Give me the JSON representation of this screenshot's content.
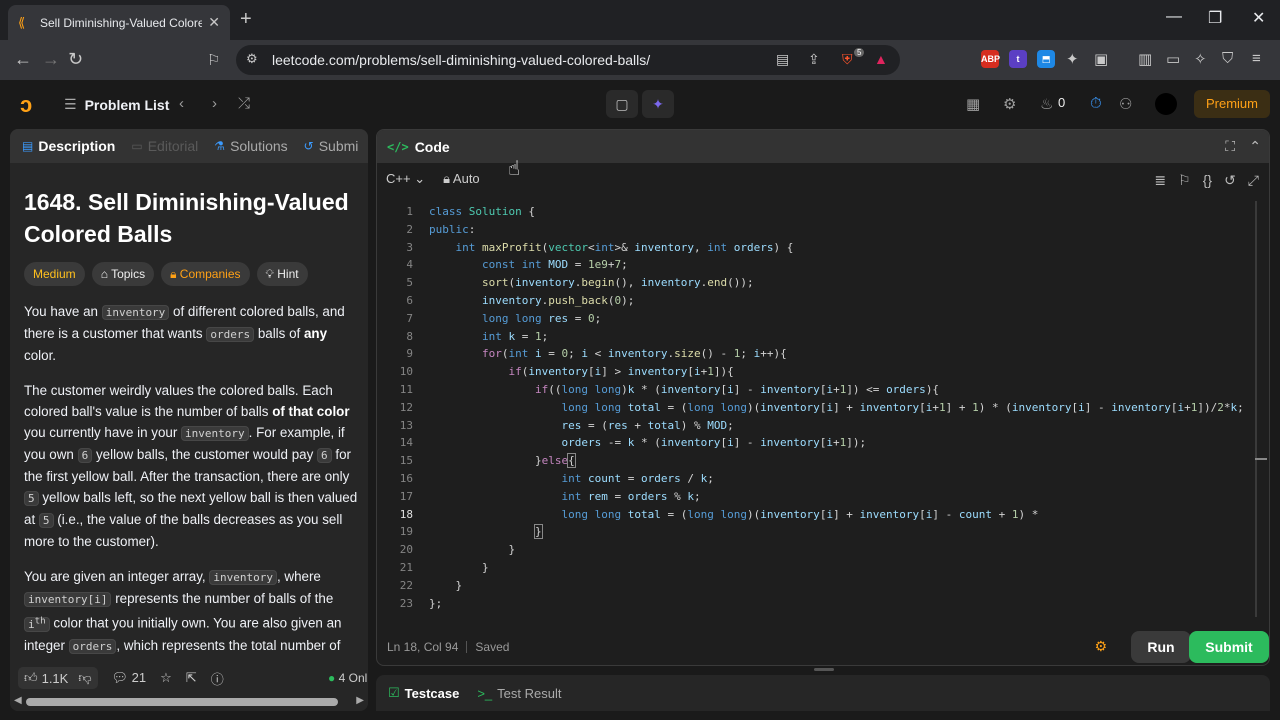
{
  "browser": {
    "tab_title": "Sell Diminishing-Valued Colored",
    "url": "leetcode.com/problems/sell-diminishing-valued-colored-balls/",
    "ext_badge": "5"
  },
  "header": {
    "problem_list": "Problem List",
    "streak": "0",
    "premium": "Premium"
  },
  "left": {
    "tabs": [
      "Description",
      "Editorial",
      "Solutions",
      "Submi"
    ],
    "title": "1648. Sell Diminishing-Valued Colored Balls",
    "tags": [
      "Medium",
      "Topics",
      "Companies",
      "Hint"
    ],
    "likes": "1.1K",
    "comments": "21",
    "online": "4 Onli"
  },
  "code": {
    "panel_title": "Code",
    "language": "C++",
    "mode": "Auto",
    "status_pos": "Ln 18, Col 94",
    "status_saved": "Saved",
    "run": "Run",
    "submit": "Submit"
  },
  "bottom": {
    "testcase": "Testcase",
    "result": "Test Result"
  },
  "colors": {
    "accent": "#ffa116",
    "green": "#2cbb5d"
  }
}
